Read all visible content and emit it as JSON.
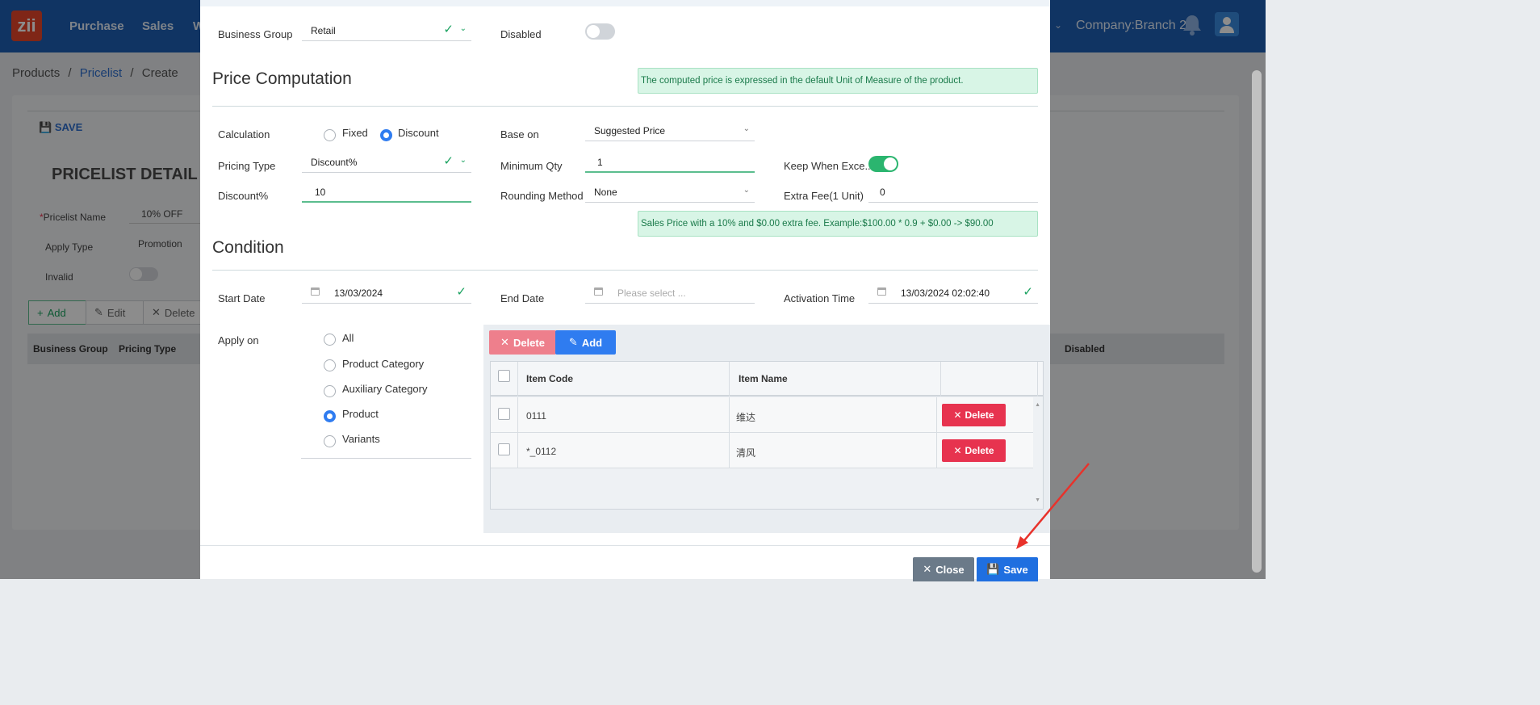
{
  "app": {
    "logo_text": "zii",
    "nav": [
      "Purchase",
      "Sales",
      "W"
    ],
    "company": "Company:Branch 2"
  },
  "breadcrumb": {
    "root": "Products",
    "sep1": "/",
    "link": "Pricelist",
    "sep2": "/",
    "current": "Create"
  },
  "background_form": {
    "save_label": "SAVE",
    "title": "PRICELIST DETAIL",
    "pricelist_name_label": "Pricelist Name",
    "pricelist_name_value": "10% OFF",
    "apply_type_label": "Apply Type",
    "apply_type_value": "Promotion",
    "invalid_label": "Invalid",
    "toolbar": {
      "add": "Add",
      "edit": "Edit",
      "delete": "Delete"
    },
    "columns": [
      "Business Group",
      "Pricing Type",
      "Disabled"
    ]
  },
  "modal": {
    "business_group_label": "Business Group",
    "business_group_value": "Retail",
    "disabled_label": "Disabled",
    "disabled_on": false,
    "price_computation_title": "Price Computation",
    "price_info": "The computed price is expressed in the default Unit of Measure of the product.",
    "calculation_label": "Calculation",
    "calc_options": [
      "Fixed",
      "Discount"
    ],
    "calc_selected": "Discount",
    "base_on_label": "Base on",
    "base_on_value": "Suggested Price",
    "pricing_type_label": "Pricing Type",
    "pricing_type_value": "Discount%",
    "min_qty_label": "Minimum Qty",
    "min_qty_value": "1",
    "keep_label": "Keep When Exce...",
    "keep_on": true,
    "discount_label": "Discount%",
    "discount_value": "10",
    "rounding_label": "Rounding Method",
    "rounding_value": "None",
    "extra_fee_label": "Extra Fee(1 Unit)",
    "extra_fee_value": "0",
    "sales_info": "Sales Price with a 10% and $0.00 extra fee. Example:$100.00 * 0.9 + $0.00 -> $90.00",
    "condition_title": "Condition",
    "start_date_label": "Start Date",
    "start_date_value": "13/03/2024",
    "end_date_label": "End Date",
    "end_date_placeholder": "Please select ...",
    "activation_label": "Activation Time",
    "activation_value": "13/03/2024 02:02:40",
    "apply_on_label": "Apply on",
    "apply_on_options": [
      "All",
      "Product Category",
      "Auxiliary Category",
      "Product",
      "Variants"
    ],
    "apply_on_selected": "Product",
    "items_toolbar": {
      "delete": "Delete",
      "add": "Add"
    },
    "items_columns": {
      "code": "Item Code",
      "name": "Item Name"
    },
    "items": [
      {
        "code": "0111",
        "name": "维达",
        "action": "Delete"
      },
      {
        "code": "*_0112",
        "name": "清风",
        "action": "Delete"
      }
    ],
    "footer": {
      "close": "Close",
      "save": "Save"
    }
  },
  "colors": {
    "primary": "#1f6fe0",
    "danger": "#e7334f",
    "success": "#2bb56f",
    "topbar": "#1e5fb4"
  }
}
